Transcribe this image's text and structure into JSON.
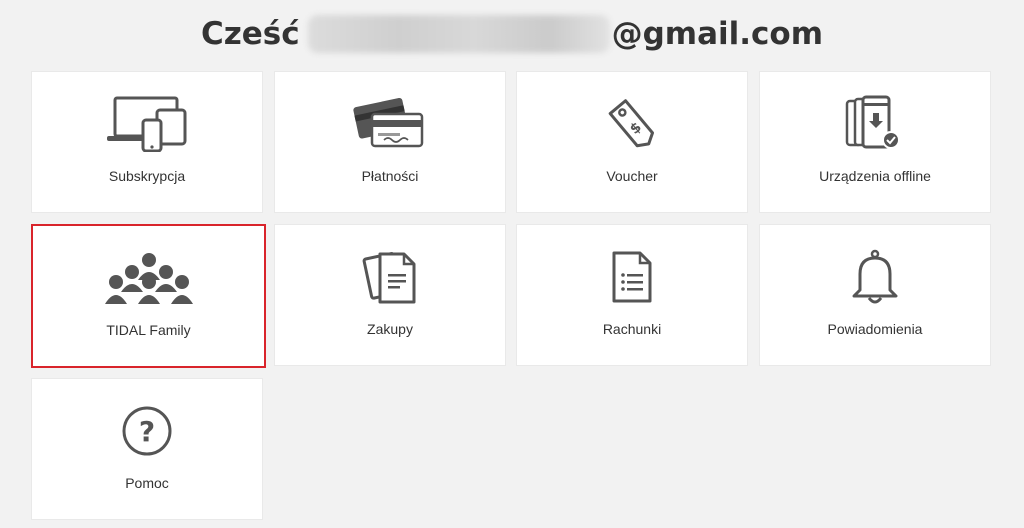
{
  "header": {
    "greeting_prefix": "Cześć",
    "greeting_suffix": "@gmail.com"
  },
  "colors": {
    "background": "#f2f2f2",
    "tile_background": "#ffffff",
    "icon_color": "#555555",
    "selected_border": "#d9242b",
    "text": "#333333"
  },
  "tiles": [
    {
      "label": "Subskrypcja",
      "icon": "devices-icon"
    },
    {
      "label": "Płatności",
      "icon": "credit-card-icon"
    },
    {
      "label": "Voucher",
      "icon": "voucher-tag-icon"
    },
    {
      "label": "Urządzenia offline",
      "icon": "offline-devices-icon"
    },
    {
      "label": "TIDAL Family",
      "icon": "family-icon",
      "selected": true
    },
    {
      "label": "Zakupy",
      "icon": "purchases-documents-icon"
    },
    {
      "label": "Rachunki",
      "icon": "invoice-document-icon"
    },
    {
      "label": "Powiadomienia",
      "icon": "bell-icon"
    },
    {
      "label": "Pomoc",
      "icon": "help-question-icon"
    }
  ]
}
